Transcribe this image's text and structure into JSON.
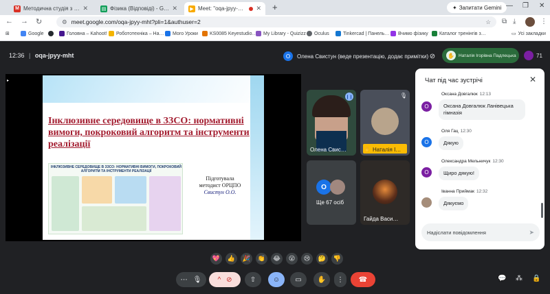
{
  "browser": {
    "tabs": [
      {
        "label": "Методична студія з фізики - …",
        "color": "#d93025",
        "letter": "M"
      },
      {
        "label": "Фізика (Відповіді) - Google Таб…",
        "color": "#0f9d58",
        "letter": "▤"
      },
      {
        "label": "Meet: \"oqa-jpyy-mht\"",
        "color": "#f9ab00",
        "letter": "▶"
      }
    ],
    "new_tab": "+",
    "gemini_label": "Запитати Gemini",
    "url": "meet.google.com/oqa-jpyy-mht?pli=1&authuser=2",
    "bookmarks": [
      {
        "label": "Google",
        "color": "#4285f4"
      },
      {
        "label": "Головна – Kahoot!",
        "color": "#46178f"
      },
      {
        "label": "Робототехніка – На…",
        "color": "#f4b400"
      },
      {
        "label": "Мого Уроки",
        "color": "#1a73e8"
      },
      {
        "label": "KS0085 Keyestudio…",
        "color": "#e37400"
      },
      {
        "label": "My Library - Quizizz",
        "color": "#8854c0"
      },
      {
        "label": "Oculus",
        "color": "#5f6368"
      },
      {
        "label": "Tinkercad | Панель…",
        "color": "#1477d1"
      },
      {
        "label": "Вчимо фізику",
        "color": "#9334e6"
      },
      {
        "label": "Каталог тренінгів з…",
        "color": "#188038"
      }
    ],
    "all_bookmarks": "Усі закладки"
  },
  "meet": {
    "time": "12:36",
    "separator": "|",
    "meeting_code": "oqa-jpyy-mht",
    "presenter_initial": "О",
    "presenting_text": "Олена Свистун (веде презентацію, додає примітки)",
    "host_name": "Наталія Ігорівна Падлецька",
    "participant_count": "71"
  },
  "slide": {
    "title": "Інклюзивне середовище в ЗЗСО: нормативні вимоги, покроковий алгоритм та інструменти реалізації",
    "infographic_heading": "ІНКЛЮЗИВНЕ СЕРЕДОВИЩЕ В ЗЗСО: НОРМАТИВНІ ВИМОГИ, ПОКРОКОВИЙ АЛГОРИТМ ТА ІНСТРУМЕНТИ РЕАЛІЗАЦІЇ",
    "byline_1": "Підготувала",
    "byline_2": "методист ОРЦПО",
    "byline_name": "Свистун О.О."
  },
  "tiles": {
    "tile1_name": "Олена Свис…",
    "tile2_name": "Наталія І…",
    "more_initial": "О",
    "more_label": "Ще 67 осіб",
    "tile4_name": "Гайда Васи…"
  },
  "chat": {
    "title": "Чат під час зустрічі",
    "messages": [
      {
        "author": "Оксана Довгалюк",
        "time": "12:13",
        "initial": "О",
        "text": "Оксана Довгалюк Ланівецька гімназія",
        "color": "#7b1fa2"
      },
      {
        "author": "Оля Гац",
        "time": "12:30",
        "initial": "О",
        "text": "Дякую",
        "color": "#1a73e8"
      },
      {
        "author": "Олександра Мельничук",
        "time": "12:30",
        "initial": "О",
        "text": "Щиро дякую!",
        "color": "#7b1fa2"
      },
      {
        "author": "Івaнна Приймак",
        "time": "12:32",
        "initial": "",
        "text": "Дякуємо",
        "color": "#a58d7a"
      }
    ],
    "input_placeholder": "Надіслати повідомлення"
  },
  "reactions": [
    "💖",
    "👍",
    "🎉",
    "👏",
    "😂",
    "😮",
    "😢",
    "🤔",
    "👎"
  ]
}
